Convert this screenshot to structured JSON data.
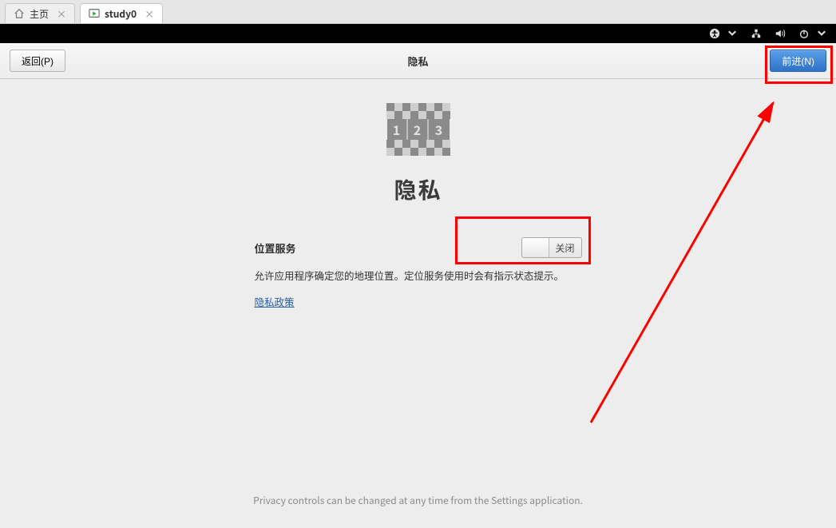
{
  "tabs": [
    {
      "label": "主页",
      "icon": "home"
    },
    {
      "label": "study0",
      "icon": "vm"
    }
  ],
  "topbar_icons": [
    "accessibility",
    "caret-down",
    "network",
    "volume",
    "power",
    "caret-down"
  ],
  "header": {
    "back_label": "返回(P)",
    "title": "隐私",
    "next_label": "前进(N)"
  },
  "page": {
    "heading": "隐私",
    "section_label": "位置服务",
    "toggle_state": "关闭",
    "description": "允许应用程序确定您的地理位置。定位服务使用时会有指示状态提示。",
    "policy_link": "隐私政策",
    "footer": "Privacy controls can be changed at any time from the Settings application."
  },
  "icon_glyphs": {
    "1": "1",
    "2": "2",
    "3": "3"
  }
}
